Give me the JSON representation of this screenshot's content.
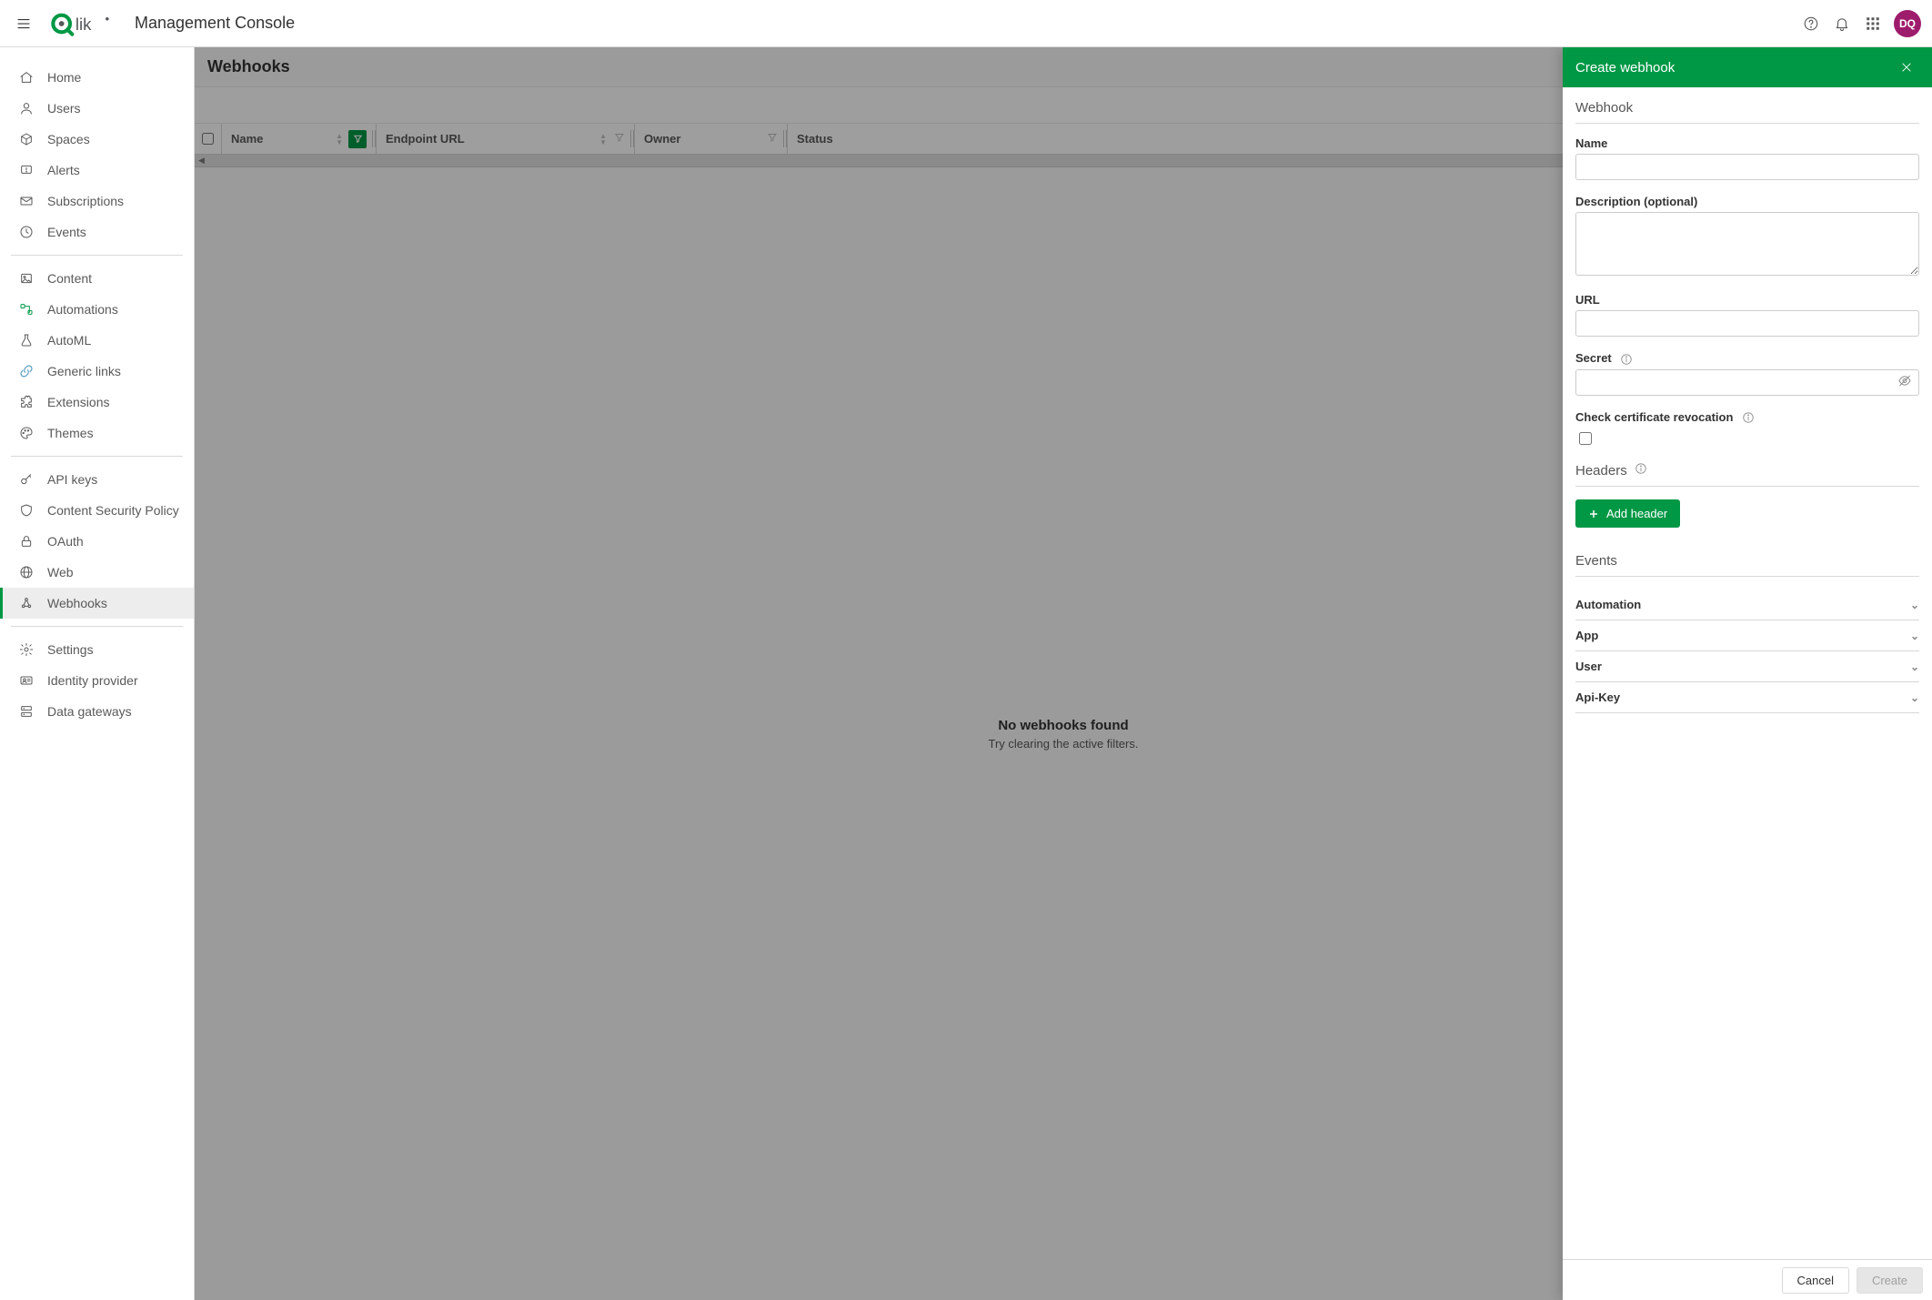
{
  "app": {
    "console_title": "Management Console",
    "avatar_initials": "DQ"
  },
  "sidenav": {
    "groups": [
      {
        "items": [
          {
            "id": "home",
            "label": "Home"
          },
          {
            "id": "users",
            "label": "Users"
          },
          {
            "id": "spaces",
            "label": "Spaces"
          },
          {
            "id": "alerts",
            "label": "Alerts"
          },
          {
            "id": "subscriptions",
            "label": "Subscriptions"
          },
          {
            "id": "events",
            "label": "Events"
          }
        ]
      },
      {
        "items": [
          {
            "id": "content",
            "label": "Content"
          },
          {
            "id": "automations",
            "label": "Automations"
          },
          {
            "id": "automl",
            "label": "AutoML"
          },
          {
            "id": "generic-links",
            "label": "Generic links"
          },
          {
            "id": "extensions",
            "label": "Extensions"
          },
          {
            "id": "themes",
            "label": "Themes"
          }
        ]
      },
      {
        "items": [
          {
            "id": "api-keys",
            "label": "API keys"
          },
          {
            "id": "csp",
            "label": "Content Security Policy"
          },
          {
            "id": "oauth",
            "label": "OAuth"
          },
          {
            "id": "web",
            "label": "Web"
          },
          {
            "id": "webhooks",
            "label": "Webhooks",
            "active": true
          }
        ]
      },
      {
        "items": [
          {
            "id": "settings",
            "label": "Settings"
          },
          {
            "id": "idp",
            "label": "Identity provider"
          },
          {
            "id": "data-gateways",
            "label": "Data gateways"
          }
        ]
      }
    ]
  },
  "page": {
    "title": "Webhooks",
    "columns": {
      "name": "Name",
      "endpoint": "Endpoint URL",
      "owner": "Owner",
      "status": "Status"
    },
    "empty_title": "No webhooks found",
    "empty_sub": "Try clearing the active filters."
  },
  "panel": {
    "title": "Create webhook",
    "section_webhook": "Webhook",
    "labels": {
      "name": "Name",
      "description": "Description (optional)",
      "url": "URL",
      "secret": "Secret",
      "check_cert": "Check certificate revocation"
    },
    "section_headers": "Headers",
    "add_header_btn": "Add header",
    "section_events": "Events",
    "event_groups": [
      "Automation",
      "App",
      "User",
      "Api-Key"
    ],
    "footer": {
      "cancel": "Cancel",
      "create": "Create"
    }
  }
}
